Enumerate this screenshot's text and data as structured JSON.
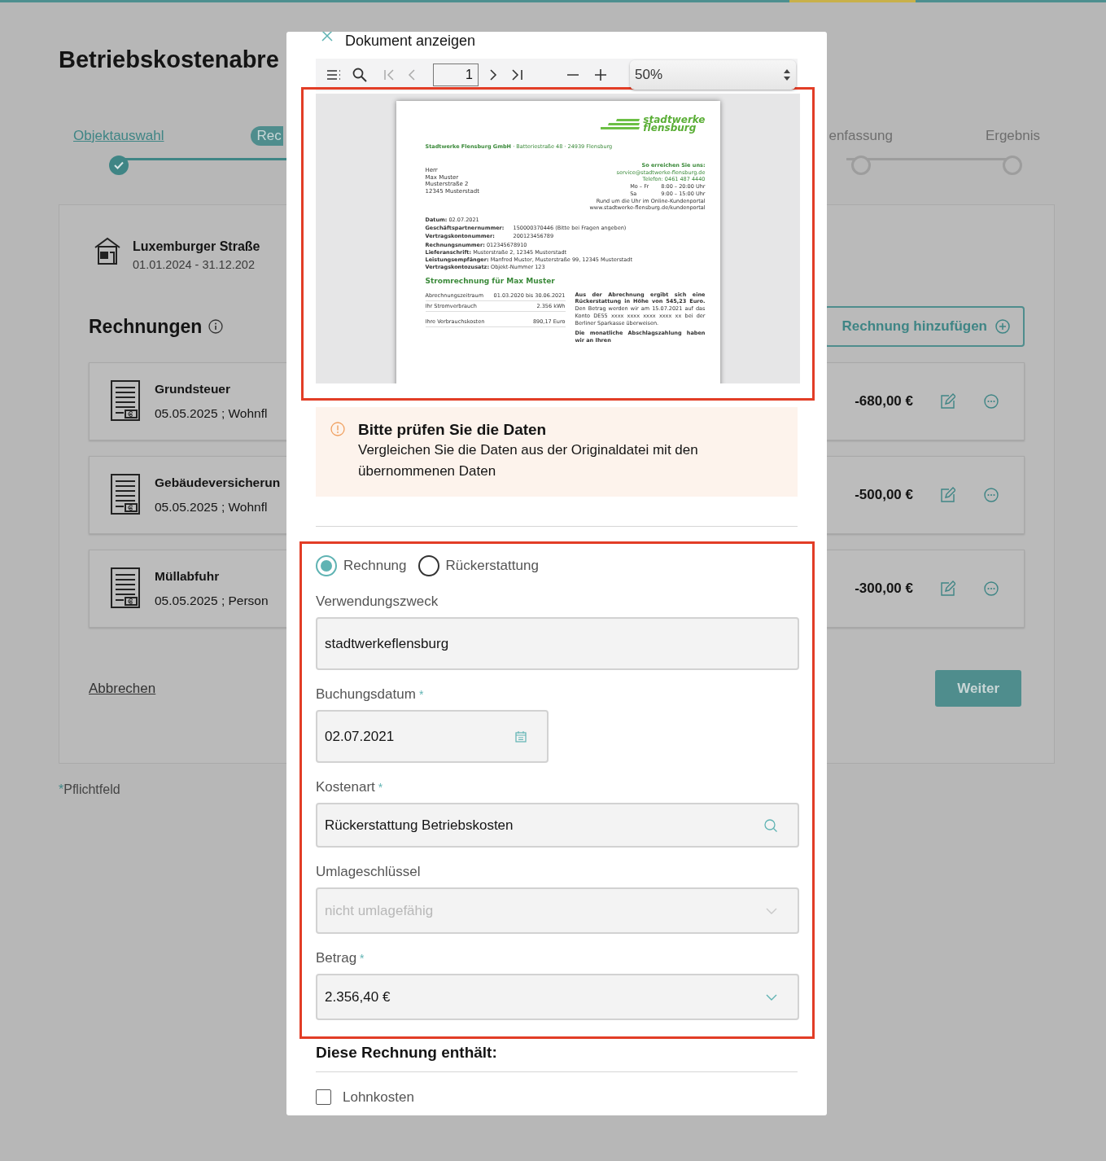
{
  "page": {
    "title": "Betriebskostenabre",
    "steps": [
      {
        "label": "Objektauswahl",
        "completed": true,
        "selected": false
      },
      {
        "label": "Rec",
        "completed": false,
        "selected": true
      },
      {
        "label": "enfassung",
        "completed": false,
        "selected": false
      },
      {
        "label": "Ergebnis",
        "completed": false,
        "selected": false
      }
    ],
    "property": {
      "name": "Luxemburger Straße",
      "period": "01.01.2024 - 31.12.202"
    },
    "section_title": "Rechnungen",
    "add_button": "Rechnung hinzufügen",
    "invoices": [
      {
        "title": "Grundsteuer",
        "details": "05.05.2025 ; Wohnfl",
        "amount": "-680,00 €"
      },
      {
        "title": "Gebäudeversicherun",
        "details": "05.05.2025 ; Wohnfl",
        "amount": "-500,00 €"
      },
      {
        "title": "Müllabfuhr",
        "details": "05.05.2025 ; Person",
        "amount": "-300,00 €"
      }
    ],
    "cancel": "Abbrechen",
    "next": "Weiter",
    "required_mark": "*",
    "required_note": "Pflichtfeld"
  },
  "modal": {
    "title": "Dokument anzeigen",
    "viewer": {
      "page": "1",
      "zoom": "50%"
    },
    "document": {
      "logo": [
        "stadtwerke",
        "flensburg"
      ],
      "sender_line": "**Stadtwerke Flensburg GmbH** · Batteriestraße 48 · 24939 Flensburg",
      "recipient": [
        "Herr",
        "Max Muster",
        "Musterstraße 2",
        "12345 Musterstadt"
      ],
      "contact_title": "So erreichen Sie uns:",
      "contact_email": "service@stadtwerke-flensburg.de",
      "contact_phone": "Telefon: 0461 487 4440",
      "hours": [
        {
          "days": "Mo – Fr",
          "time": "8:00 – 20:00 Uhr"
        },
        {
          "days": "Sa",
          "time": "9:00 – 15:00 Uhr"
        }
      ],
      "portal": [
        "Rund um die Uhr im Online-Kundenportal",
        "www.stadtwerke-flensburg.de/kundenportal"
      ],
      "date_line": "**Datum:** 02.07.2021",
      "ids": [
        {
          "label": "Geschäftspartnernummer:",
          "value": "150000370446 (Bitte bei Fragen angeben)"
        },
        {
          "label": "Vertragskontonummer:",
          "value": "200123456789"
        }
      ],
      "details": [
        "**Rechnungsnummer:** 012345678910",
        "**Lieferanschrift:** Musterstraße 2, 12345 Musterstadt",
        "**Leistungsempfänger:** Manfred Muster, Musterstraße 99, 12345 Musterstadt",
        "**Vertragskontozusatz:** Objekt-Nummer 123"
      ],
      "heading": "Stromrechnung für Max Muster",
      "summary": [
        {
          "label": "Abrechnungszeitraum",
          "value": "01.03.2020 bis 30.06.2021"
        },
        {
          "label": "Ihr Stromverbrauch",
          "value": "2.356 kWh"
        },
        {
          "label": "Ihre Verbrauchskosten",
          "value": "890,17 Euro"
        }
      ],
      "refund_note": "**Aus der Abrechnung ergibt sich eine Rückerstattung in Höhe von 545,23 Euro.** Den Betrag werden wir am 15.07.2021 auf das Konto DE55 xxxx xxxx xxxx xxxx xx bei der Berliner Sparkasse überweisen.",
      "installment_note": "Die monatliche Abschlagszahlung haben wir an Ihren"
    },
    "alert": {
      "title": "Bitte prüfen Sie die Daten",
      "text": "Vergleichen Sie die Daten aus der Originaldatei mit den übernommenen Daten"
    },
    "type_options": [
      {
        "label": "Rechnung",
        "selected": true
      },
      {
        "label": "Rückerstattung",
        "selected": false
      }
    ],
    "fields": [
      {
        "kind": "text",
        "label": "Verwendungszweck",
        "value": "stadtwerkeflensburg"
      },
      {
        "kind": "date",
        "label": "Buchungsdatum",
        "mark": "*",
        "value": "02.07.2021"
      },
      {
        "kind": "search",
        "label": "Kostenart",
        "mark": "*",
        "value": "Rückerstattung Betriebskosten"
      },
      {
        "kind": "select",
        "label": "Umlageschlüssel",
        "value": "nicht umlagefähig",
        "disabled": true
      },
      {
        "kind": "select",
        "label": "Betrag",
        "mark": "*",
        "value": "2.356,40 €"
      }
    ],
    "contains": {
      "title": "Diese Rechnung enthält:",
      "options": [
        {
          "label": "Lohnkosten",
          "checked": false
        }
      ]
    }
  }
}
